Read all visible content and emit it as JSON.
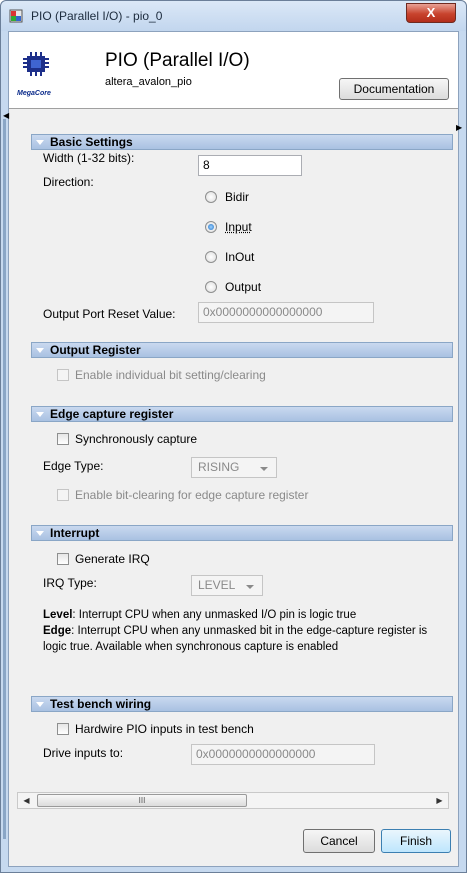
{
  "window": {
    "title": "PIO (Parallel I/O) - pio_0",
    "close_label": "X"
  },
  "header": {
    "title": "PIO (Parallel I/O)",
    "subtitle": "altera_avalon_pio",
    "logo_text": "MegaCore",
    "documentation_label": "Documentation"
  },
  "basic_settings": {
    "heading": "Basic Settings",
    "width_label": "Width (1-32 bits):",
    "width_value": "8",
    "direction_label": "Direction:",
    "direction_options": [
      "Bidir",
      "Input",
      "InOut",
      "Output"
    ],
    "direction_selected": "Input",
    "reset_label": "Output Port Reset Value:",
    "reset_value": "0x0000000000000000"
  },
  "output_register": {
    "heading": "Output Register",
    "bit_setting_label": "Enable individual bit setting/clearing"
  },
  "edge_capture": {
    "heading": "Edge capture register",
    "sync_label": "Synchronously capture",
    "edge_type_label": "Edge Type:",
    "edge_type_value": "RISING",
    "bit_clearing_label": "Enable bit-clearing for edge capture register"
  },
  "interrupt": {
    "heading": "Interrupt",
    "generate_irq_label": "Generate IRQ",
    "irq_type_label": "IRQ Type:",
    "irq_type_value": "LEVEL",
    "level_term": "Level",
    "level_desc": ": Interrupt CPU when any unmasked I/O pin is logic true",
    "edge_term": "Edge",
    "edge_desc": ": Interrupt CPU when any unmasked bit in the edge-capture register is logic true. Available when synchronous capture is enabled"
  },
  "test_bench": {
    "heading": "Test bench wiring",
    "hardwire_label": "Hardwire PIO inputs in test bench",
    "drive_label": "Drive inputs to:",
    "drive_value": "0x0000000000000000"
  },
  "scrollbar": {
    "thumb_grip": "III"
  },
  "footer": {
    "cancel_label": "Cancel",
    "finish_label": "Finish"
  }
}
